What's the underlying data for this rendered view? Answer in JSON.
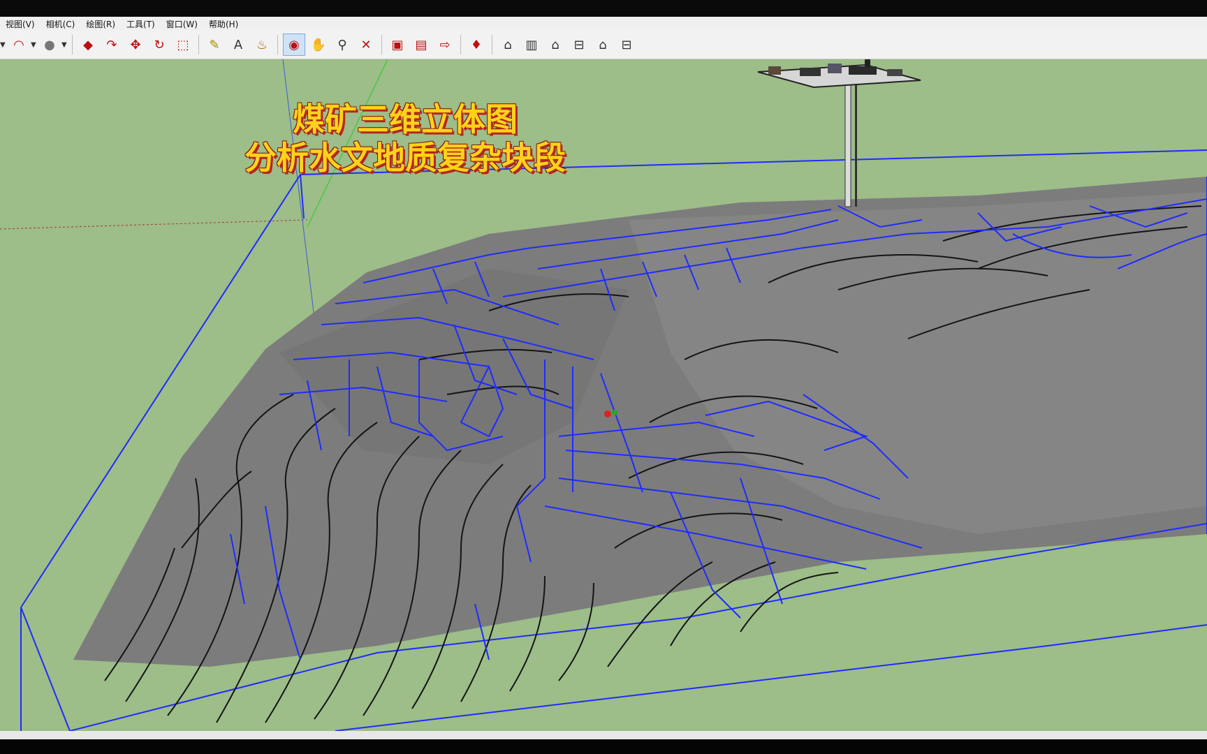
{
  "menu": [
    "视图(V)",
    "相机(C)",
    "绘图(R)",
    "工具(T)",
    "窗口(W)",
    "帮助(H)"
  ],
  "toolbar_icons": [
    "dropdown-icon",
    "arc-tool-icon",
    "dropdown-icon",
    "circle-tool-icon",
    "dropdown-icon",
    "push-pull-icon",
    "follow-me-icon",
    "move-icon",
    "rotate-icon",
    "scale-icon",
    "tape-measure-icon",
    "text-tool-icon",
    "paint-bucket-icon",
    "orbit-icon",
    "pan-icon",
    "zoom-icon",
    "zoom-extents-icon",
    "components-icon",
    "3d-warehouse-icon",
    "share-model-icon",
    "ruby-icon",
    "iso-view-icon",
    "top-view-icon",
    "front-view-icon",
    "right-view-icon",
    "back-view-icon",
    "left-view-icon"
  ],
  "overlay": {
    "line1": "煤矿三维立体图",
    "line2": "分析水文地质复杂块段"
  },
  "colors": {
    "sky": "#9dbd89",
    "terrain": "#7c7c7c",
    "tunnel": "#1f2bff",
    "contour": "#141414",
    "title_fill": "#ffd21a",
    "title_shadow": "#b3261e"
  }
}
